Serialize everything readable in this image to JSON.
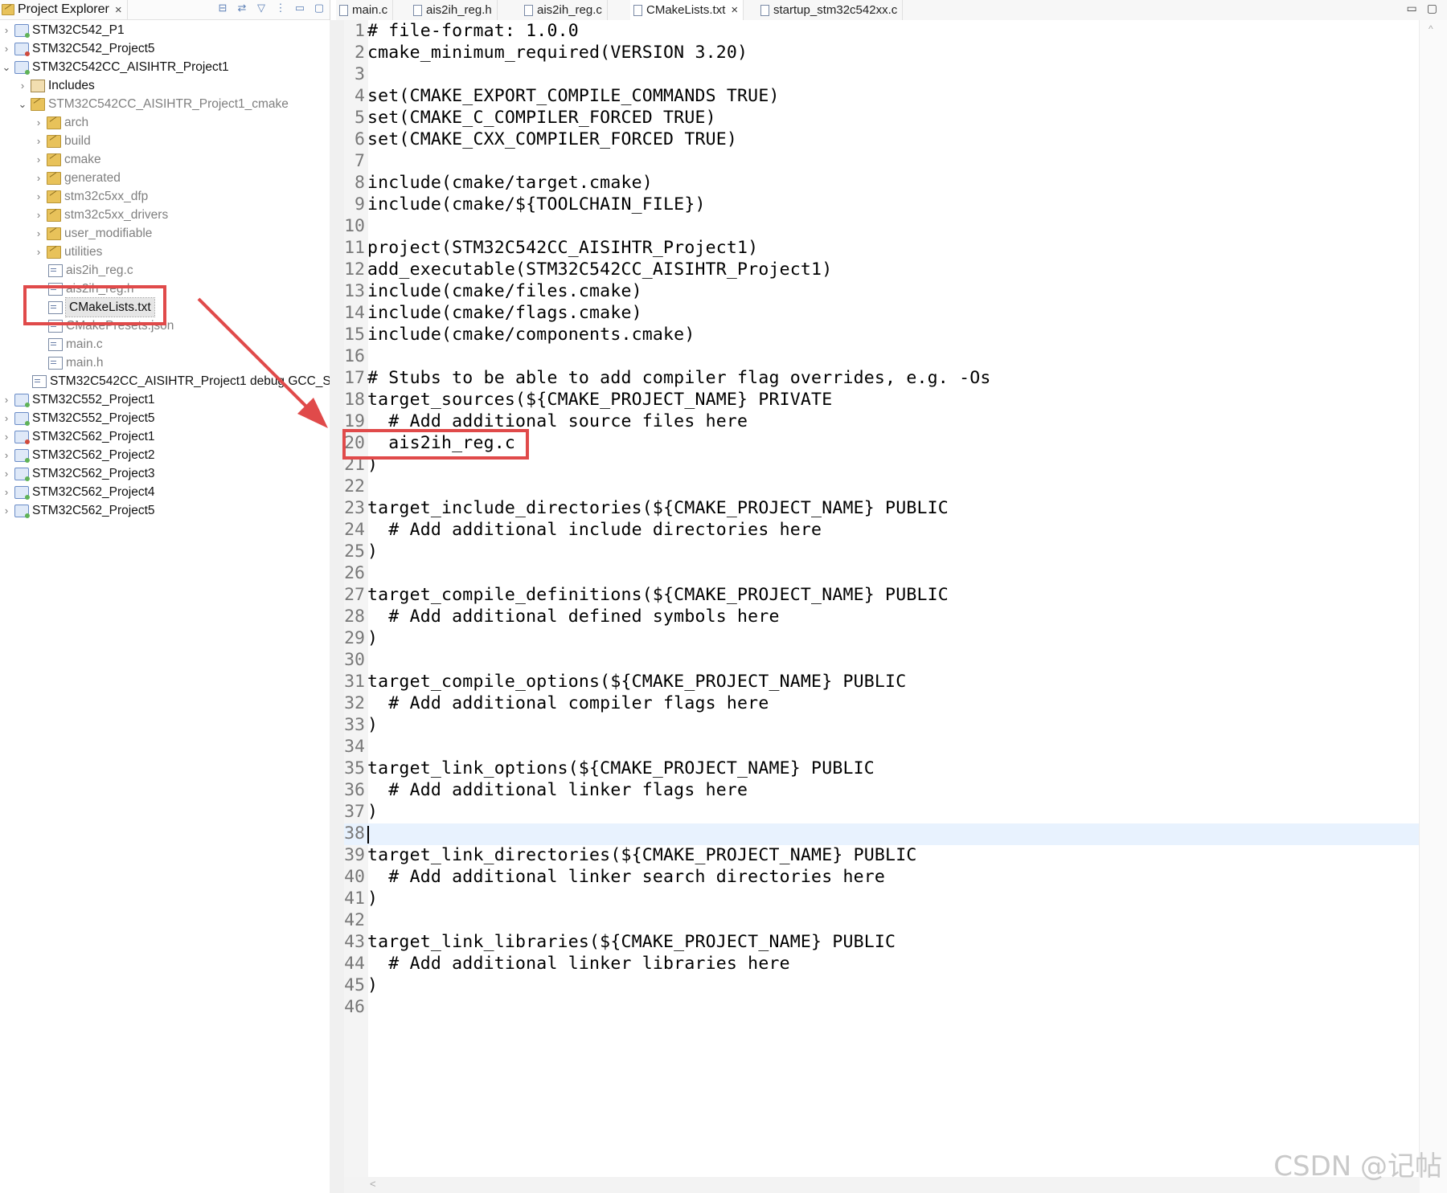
{
  "explorer": {
    "title": "Project Explorer",
    "close": "×",
    "tools": [
      "⊟",
      "⇄",
      "▽",
      "⋮",
      "▭",
      "▢"
    ],
    "tree": [
      {
        "label": "STM32C542_P1",
        "indent": 0,
        "chev": "›",
        "icon": "project",
        "dim": false
      },
      {
        "label": "STM32C542_Project5",
        "indent": 0,
        "chev": "›",
        "icon": "project-red",
        "dim": false
      },
      {
        "label": "STM32C542CC_AISIHTR_Project1",
        "indent": 0,
        "chev": "⌄",
        "icon": "project",
        "dim": false
      },
      {
        "label": "Includes",
        "indent": 1,
        "chev": "›",
        "icon": "include",
        "dim": false
      },
      {
        "label": "STM32C542CC_AISIHTR_Project1_cmake",
        "indent": 1,
        "chev": "⌄",
        "icon": "folder",
        "dim": true
      },
      {
        "label": "arch",
        "indent": 2,
        "chev": "›",
        "icon": "folder",
        "dim": true
      },
      {
        "label": "build",
        "indent": 2,
        "chev": "›",
        "icon": "folder",
        "dim": true
      },
      {
        "label": "cmake",
        "indent": 2,
        "chev": "›",
        "icon": "folder",
        "dim": true
      },
      {
        "label": "generated",
        "indent": 2,
        "chev": "›",
        "icon": "folder",
        "dim": true
      },
      {
        "label": "stm32c5xx_dfp",
        "indent": 2,
        "chev": "›",
        "icon": "folder",
        "dim": true
      },
      {
        "label": "stm32c5xx_drivers",
        "indent": 2,
        "chev": "›",
        "icon": "folder",
        "dim": true
      },
      {
        "label": "user_modifiable",
        "indent": 2,
        "chev": "›",
        "icon": "folder",
        "dim": true
      },
      {
        "label": "utilities",
        "indent": 2,
        "chev": "›",
        "icon": "folder",
        "dim": true
      },
      {
        "label": "ais2ih_reg.c",
        "indent": 2,
        "chev": "",
        "icon": "file",
        "dim": true
      },
      {
        "label": "ais2ih_reg.h",
        "indent": 2,
        "chev": "",
        "icon": "file",
        "dim": true
      },
      {
        "label": "CMakeLists.txt",
        "indent": 2,
        "chev": "",
        "icon": "file",
        "dim": false,
        "selected": true
      },
      {
        "label": "CMakePresets.json",
        "indent": 2,
        "chev": "",
        "icon": "file",
        "dim": true
      },
      {
        "label": "main.c",
        "indent": 2,
        "chev": "",
        "icon": "file",
        "dim": true
      },
      {
        "label": "main.h",
        "indent": 2,
        "chev": "",
        "icon": "file",
        "dim": true
      },
      {
        "label": "STM32C542CC_AISIHTR_Project1 debug GCC_S",
        "indent": 1,
        "chev": "",
        "icon": "file",
        "dim": false
      },
      {
        "label": "STM32C552_Project1",
        "indent": 0,
        "chev": "›",
        "icon": "project",
        "dim": false
      },
      {
        "label": "STM32C552_Project5",
        "indent": 0,
        "chev": "›",
        "icon": "project",
        "dim": false
      },
      {
        "label": "STM32C562_Project1",
        "indent": 0,
        "chev": "›",
        "icon": "project-red",
        "dim": false
      },
      {
        "label": "STM32C562_Project2",
        "indent": 0,
        "chev": "›",
        "icon": "project",
        "dim": false
      },
      {
        "label": "STM32C562_Project3",
        "indent": 0,
        "chev": "›",
        "icon": "project",
        "dim": false
      },
      {
        "label": "STM32C562_Project4",
        "indent": 0,
        "chev": "›",
        "icon": "project",
        "dim": false
      },
      {
        "label": "STM32C562_Project5",
        "indent": 0,
        "chev": "›",
        "icon": "project",
        "dim": false
      }
    ]
  },
  "editor": {
    "tabs": [
      {
        "label": "main.c",
        "active": false
      },
      {
        "label": "ais2ih_reg.h",
        "active": false
      },
      {
        "label": "ais2ih_reg.c",
        "active": false
      },
      {
        "label": "CMakeLists.txt",
        "active": true
      },
      {
        "label": "startup_stm32c542xx.c",
        "active": false
      }
    ],
    "tab_close": "×",
    "window_controls": [
      "▭",
      "▢"
    ],
    "current_line": 38,
    "lines": [
      "# file-format: 1.0.0",
      "cmake_minimum_required(VERSION 3.20)",
      "",
      "set(CMAKE_EXPORT_COMPILE_COMMANDS TRUE)",
      "set(CMAKE_C_COMPILER_FORCED TRUE)",
      "set(CMAKE_CXX_COMPILER_FORCED TRUE)",
      "",
      "include(cmake/target.cmake)",
      "include(cmake/${TOOLCHAIN_FILE})",
      "",
      "project(STM32C542CC_AISIHTR_Project1)",
      "add_executable(STM32C542CC_AISIHTR_Project1)",
      "include(cmake/files.cmake)",
      "include(cmake/flags.cmake)",
      "include(cmake/components.cmake)",
      "",
      "# Stubs to be able to add compiler flag overrides, e.g. -Os",
      "target_sources(${CMAKE_PROJECT_NAME} PRIVATE",
      "  # Add additional source files here",
      "  ais2ih_reg.c",
      ")",
      "",
      "target_include_directories(${CMAKE_PROJECT_NAME} PUBLIC",
      "  # Add additional include directories here",
      ")",
      "",
      "target_compile_definitions(${CMAKE_PROJECT_NAME} PUBLIC",
      "  # Add additional defined symbols here",
      ")",
      "",
      "target_compile_options(${CMAKE_PROJECT_NAME} PUBLIC",
      "  # Add additional compiler flags here",
      ")",
      "",
      "target_link_options(${CMAKE_PROJECT_NAME} PUBLIC",
      "  # Add additional linker flags here",
      ")",
      "",
      "target_link_directories(${CMAKE_PROJECT_NAME} PUBLIC",
      "  # Add additional linker search directories here",
      ")",
      "",
      "target_link_libraries(${CMAKE_PROJECT_NAME} PUBLIC",
      "  # Add additional linker libraries here",
      ")",
      ""
    ]
  },
  "scroll": {
    "up": "^",
    "left": "<"
  },
  "watermark": "CSDN @记帖",
  "colors": {
    "annotation": "#e04a4a",
    "current_line": "#e8f2fe"
  }
}
